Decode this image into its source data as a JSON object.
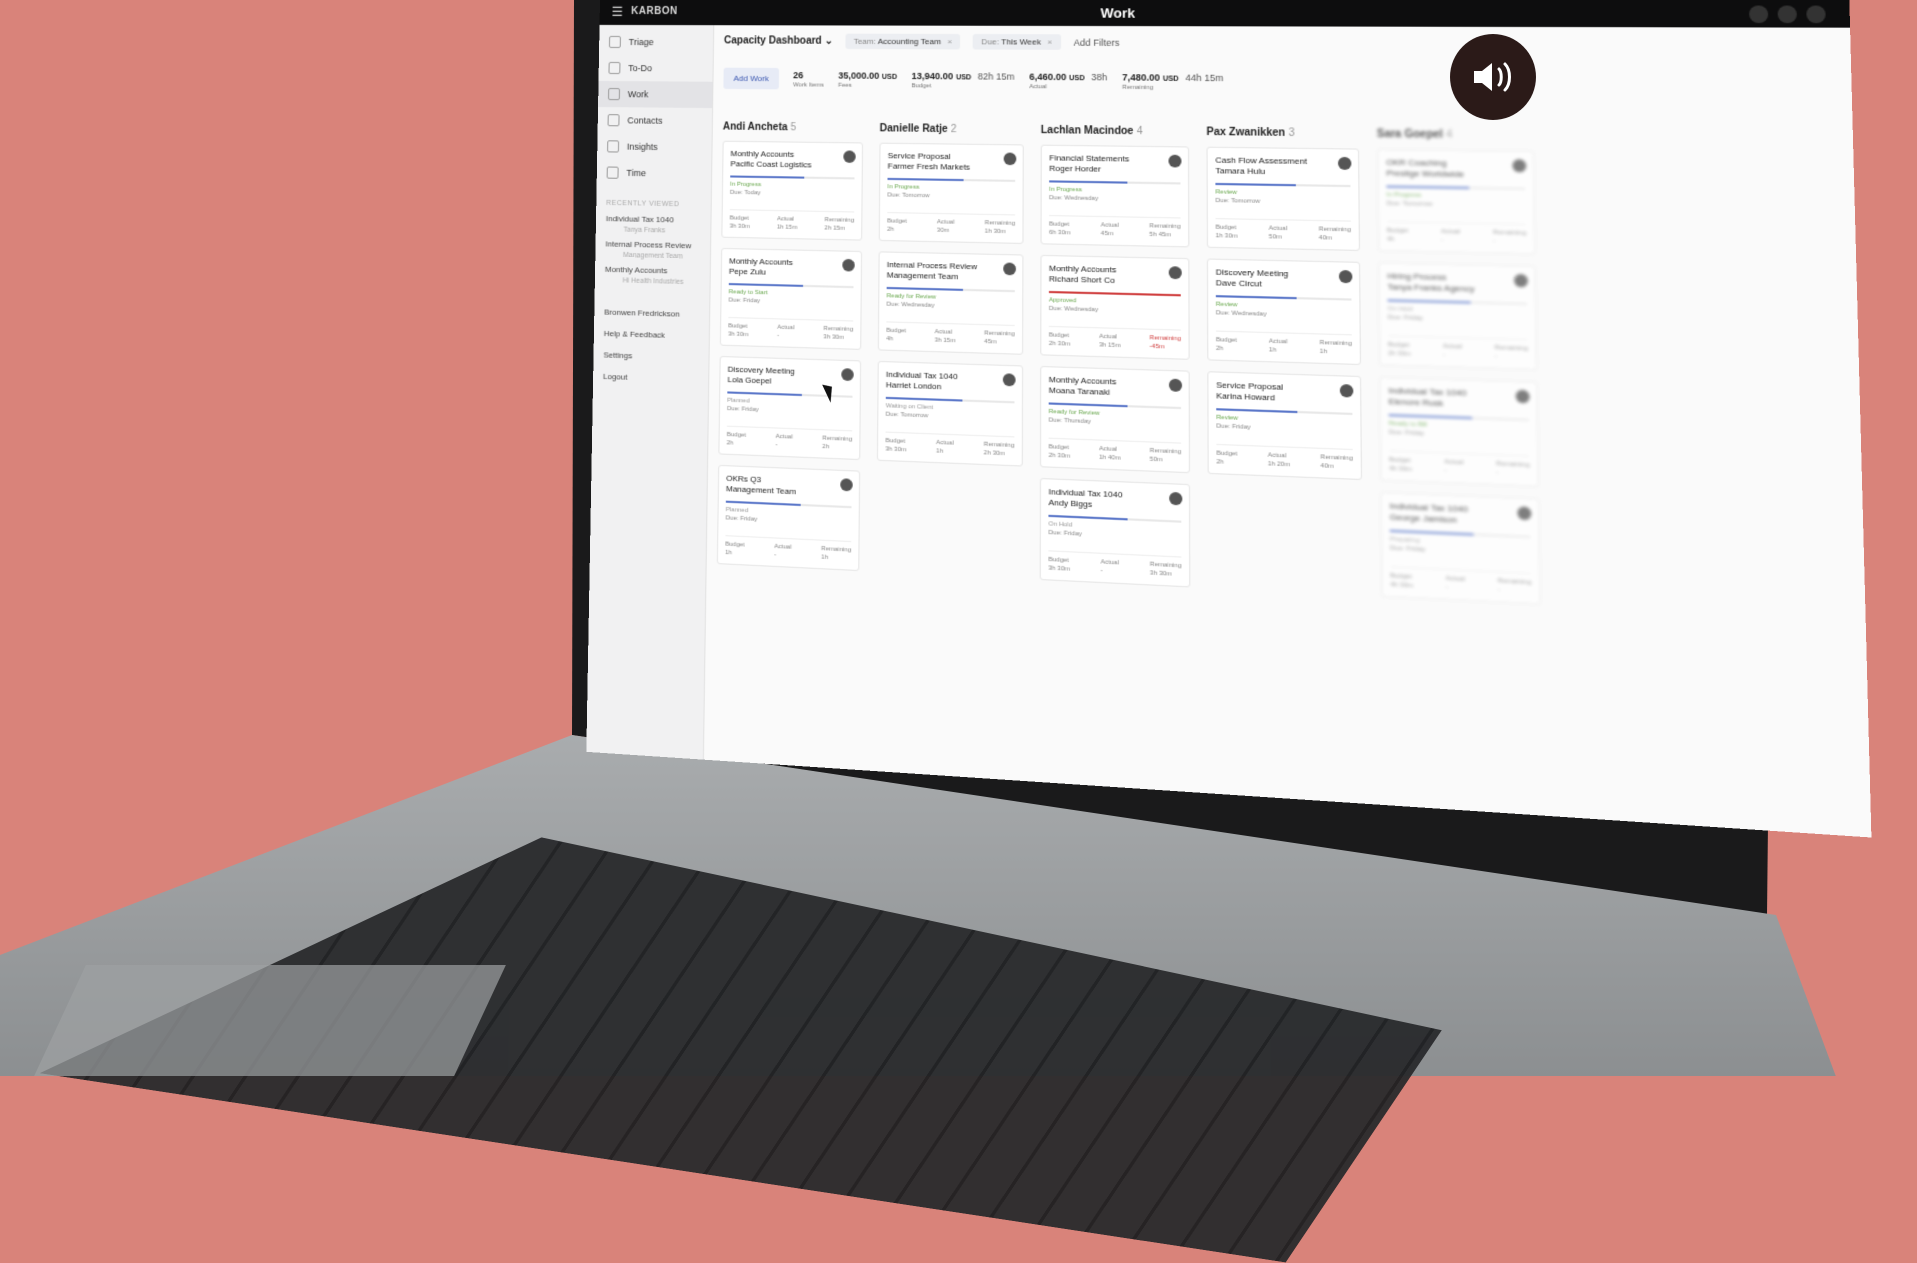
{
  "app": {
    "menu_icon": "☰",
    "brand": "KARBON",
    "window_title": "Work"
  },
  "sidebar": {
    "items": [
      {
        "label": "Triage"
      },
      {
        "label": "To-Do"
      },
      {
        "label": "Work"
      },
      {
        "label": "Contacts"
      },
      {
        "label": "Insights"
      },
      {
        "label": "Time"
      }
    ],
    "section_label": "RECENTLY VIEWED",
    "recent": [
      {
        "label": "Individual Tax 1040",
        "sub": "Tanya Franks"
      },
      {
        "label": "Internal Process Review",
        "sub": "Management Team"
      },
      {
        "label": "Monthly Accounts",
        "sub": "Hi Health Industries"
      }
    ],
    "user": "Bronwen Fredrickson",
    "help": "Help & Feedback",
    "settings": "Settings",
    "logout": "Logout"
  },
  "toolbar": {
    "view": "Capacity Dashboard",
    "filter_team_key": "Team:",
    "filter_team_val": "Accounting Team",
    "filter_due_key": "Due:",
    "filter_due_val": "This Week",
    "add_filters": "Add Filters"
  },
  "stats": {
    "add_work": "Add Work",
    "work_items": "26",
    "work_items_label": "Work Items",
    "fees": "35,000.00",
    "fees_unit": "USD",
    "fees_label": "Fees",
    "budget": "13,940.00",
    "budget_unit": "USD",
    "budget_time": "82h 15m",
    "budget_label": "Budget",
    "actual": "6,460.00",
    "actual_unit": "USD",
    "actual_time": "38h",
    "actual_label": "Actual",
    "remaining": "7,480.00",
    "remaining_unit": "USD",
    "remaining_time": "44h 15m",
    "remaining_label": "Remaining"
  },
  "columns": [
    {
      "name": "Andi Ancheta",
      "count": "5",
      "cards": [
        {
          "title": "Monthly Accounts",
          "client": "Pacific Coast Logistics",
          "status": "In Progress",
          "due": "Due: Today",
          "budget": "3h 30m",
          "actual": "1h 15m",
          "remaining": "2h 15m"
        },
        {
          "title": "Monthly Accounts",
          "client": "Pepe Zulu",
          "status": "Ready to Start",
          "due": "Due: Friday",
          "budget": "3h 30m",
          "actual": "-",
          "remaining": "3h 30m"
        },
        {
          "title": "Discovery Meeting",
          "client": "Lola Goepel",
          "status": "Planned",
          "due": "Due: Friday",
          "budget": "2h",
          "actual": "-",
          "remaining": "2h"
        },
        {
          "title": "OKRs Q3",
          "client": "Management Team",
          "status": "Planned",
          "due": "Due: Friday",
          "budget": "1h",
          "actual": "-",
          "remaining": "1h"
        }
      ]
    },
    {
      "name": "Danielle Ratje",
      "count": "2",
      "cards": [
        {
          "title": "Service Proposal",
          "client": "Farmer Fresh Markets",
          "status": "In Progress",
          "due": "Due: Tomorrow",
          "budget": "2h",
          "actual": "30m",
          "remaining": "1h 30m"
        },
        {
          "title": "Internal Process Review",
          "client": "Management Team",
          "status": "Ready for Review",
          "due": "Due: Wednesday",
          "budget": "4h",
          "actual": "3h 15m",
          "remaining": "45m"
        },
        {
          "title": "Individual Tax 1040",
          "client": "Harriet London",
          "status": "Waiting on Client",
          "due": "Due: Tomorrow",
          "budget": "3h 30m",
          "actual": "1h",
          "remaining": "2h 30m"
        }
      ]
    },
    {
      "name": "Lachlan Macindoe",
      "count": "4",
      "cards": [
        {
          "title": "Financial Statements",
          "client": "Roger Horder",
          "status": "In Progress",
          "due": "Due: Wednesday",
          "budget": "6h 30m",
          "actual": "45m",
          "remaining": "5h 45m"
        },
        {
          "title": "Monthly Accounts",
          "client": "Richard Short Co",
          "status": "Approved",
          "due": "Due: Wednesday",
          "budget": "2h 30m",
          "actual": "3h 15m",
          "remaining": "-45m"
        },
        {
          "title": "Monthly Accounts",
          "client": "Moana Taranaki",
          "status": "Ready for Review",
          "due": "Due: Thursday",
          "budget": "2h 30m",
          "actual": "1h 40m",
          "remaining": "50m"
        },
        {
          "title": "Individual Tax 1040",
          "client": "Andy Biggs",
          "status": "On Hold",
          "due": "Due: Friday",
          "budget": "3h 30m",
          "actual": "-",
          "remaining": "3h 30m"
        }
      ]
    },
    {
      "name": "Pax Zwanikken",
      "count": "3",
      "cards": [
        {
          "title": "Cash Flow Assessment",
          "client": "Tamara Hulu",
          "status": "Review",
          "due": "Due: Tomorrow",
          "budget": "1h 30m",
          "actual": "50m",
          "remaining": "40m"
        },
        {
          "title": "Discovery Meeting",
          "client": "Dave Circut",
          "status": "Review",
          "due": "Due: Wednesday",
          "budget": "2h",
          "actual": "1h",
          "remaining": "1h"
        },
        {
          "title": "Service Proposal",
          "client": "Karina Howard",
          "status": "Review",
          "due": "Due: Friday",
          "budget": "2h",
          "actual": "1h 20m",
          "remaining": "40m"
        }
      ]
    },
    {
      "name": "Sara Goepel",
      "count": "4",
      "cards": [
        {
          "title": "OKR Coaching",
          "client": "Prestige Worldwide",
          "status": "In Progress",
          "due": "Due: Tomorrow",
          "budget": "4h",
          "actual": "-",
          "remaining": "-"
        },
        {
          "title": "Hiring Process",
          "client": "Tanya Franks Agency",
          "status": "On Hold",
          "due": "Due: Friday",
          "budget": "2h 30m",
          "actual": "-",
          "remaining": "-"
        },
        {
          "title": "Individual Tax 1040",
          "client": "Elenore Rusk",
          "status": "Ready to Bill",
          "due": "Due: Friday",
          "budget": "4h 30m",
          "actual": "-",
          "remaining": "-"
        },
        {
          "title": "Individual Tax 1040",
          "client": "George Jamison",
          "status": "Preparing",
          "due": "Due: Friday",
          "budget": "4h 30m",
          "actual": "-",
          "remaining": "-"
        }
      ]
    }
  ],
  "labels": {
    "budget": "Budget",
    "actual": "Actual",
    "remaining": "Remaining"
  },
  "colors": {
    "in_progress": "#6aa84f",
    "review": "#6aa84f",
    "ready": "#6aa84f",
    "over": "#d04040",
    "bar": "#5b77c9",
    "accent": "#3a56b0"
  },
  "sound_icon": "speaker-icon"
}
